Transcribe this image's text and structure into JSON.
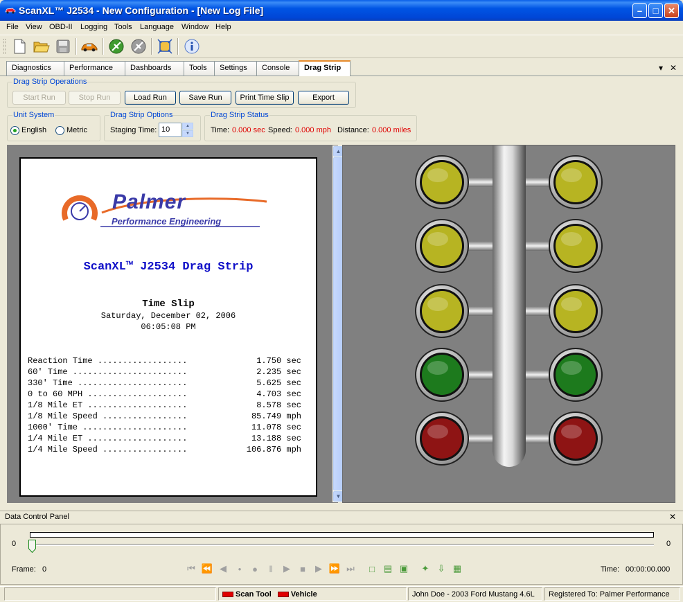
{
  "window": {
    "title": "ScanXL™ J2534 - New Configuration - [New Log File]",
    "min_label": "–",
    "max_label": "□",
    "close_label": "✕"
  },
  "menu": [
    "File",
    "View",
    "OBD-II",
    "Logging",
    "Tools",
    "Language",
    "Window",
    "Help"
  ],
  "toolbar_icons": [
    "new-file-icon",
    "open-folder-icon",
    "save-icon",
    "vehicle-icon",
    "connect-icon",
    "disconnect-icon",
    "fit-screen-icon",
    "info-icon"
  ],
  "tabs": [
    "Diagnostics",
    "Performance",
    "Dashboards",
    "Tools",
    "Settings",
    "Console",
    "Drag Strip"
  ],
  "active_tab": "Drag Strip",
  "tab_controls": {
    "dropdown": "▾",
    "close": "✕"
  },
  "ops": {
    "label": "Drag Strip Operations",
    "start_run": "Start Run",
    "stop_run": "Stop Run",
    "load_run": "Load Run",
    "save_run": "Save Run",
    "print_slip": "Print Time Slip",
    "export": "Export"
  },
  "units": {
    "label": "Unit System",
    "english": "English",
    "metric": "Metric",
    "selected": "English"
  },
  "options": {
    "label": "Drag Strip Options",
    "staging_label": "Staging Time:",
    "staging_value": "10"
  },
  "status": {
    "label": "Drag Strip Status",
    "time_label": "Time:",
    "time_value": "0.000 sec",
    "speed_label": "Speed:",
    "speed_value": "0.000 mph",
    "distance_label": "Distance:",
    "distance_value": "0.000 miles"
  },
  "slip": {
    "logo_name": "Palmer",
    "logo_tagline": "Performance Engineering",
    "heading": "ScanXL™ J2534 Drag Strip",
    "title": "Time Slip",
    "date": "Saturday, December 02, 2006",
    "time": "06:05:08 PM",
    "rows": [
      {
        "label": "Reaction Time ..................",
        "value": "1.750 sec"
      },
      {
        "label": "60' Time .......................",
        "value": "2.235 sec"
      },
      {
        "label": "330' Time ......................",
        "value": "5.625 sec"
      },
      {
        "label": "0 to 60 MPH ....................",
        "value": "4.703 sec"
      },
      {
        "label": "1/8 Mile ET ....................",
        "value": "8.578 sec"
      },
      {
        "label": "1/8 Mile Speed .................",
        "value": "85.749 mph"
      },
      {
        "label": "1000' Time .....................",
        "value": "11.078 sec"
      },
      {
        "label": "1/4 Mile ET ....................",
        "value": "13.188 sec"
      },
      {
        "label": "1/4 Mile Speed .................",
        "value": "106.876 mph"
      }
    ]
  },
  "tree": {
    "colors": {
      "amber": "#b7b422",
      "green": "#1d7a1d",
      "red": "#8e1414"
    },
    "lights": [
      "amber",
      "amber",
      "amber",
      "green",
      "red"
    ]
  },
  "dcp": {
    "title": "Data Control Panel",
    "close": "✕",
    "min": "0",
    "max": "0",
    "frame_label": "Frame:",
    "frame_value": "0",
    "time_label": "Time:",
    "time_value": "00:00:00.000",
    "playback_icons": [
      "skip-start-icon",
      "rewind-fast-icon",
      "step-back-icon",
      "record-small-icon",
      "record-icon",
      "pause-icon",
      "play-icon",
      "stop-icon",
      "step-forward-icon",
      "forward-fast-icon",
      "skip-end-icon",
      "new-log-icon",
      "open-log-icon",
      "save-log-icon",
      "tag-icon",
      "export-log-icon",
      "grid-icon"
    ]
  },
  "statusbar": {
    "scan_tool": "Scan Tool",
    "vehicle": "Vehicle",
    "vehicle_info": "John Doe - 2003 Ford Mustang 4.6L",
    "registered": "Registered To: Palmer Performance"
  }
}
